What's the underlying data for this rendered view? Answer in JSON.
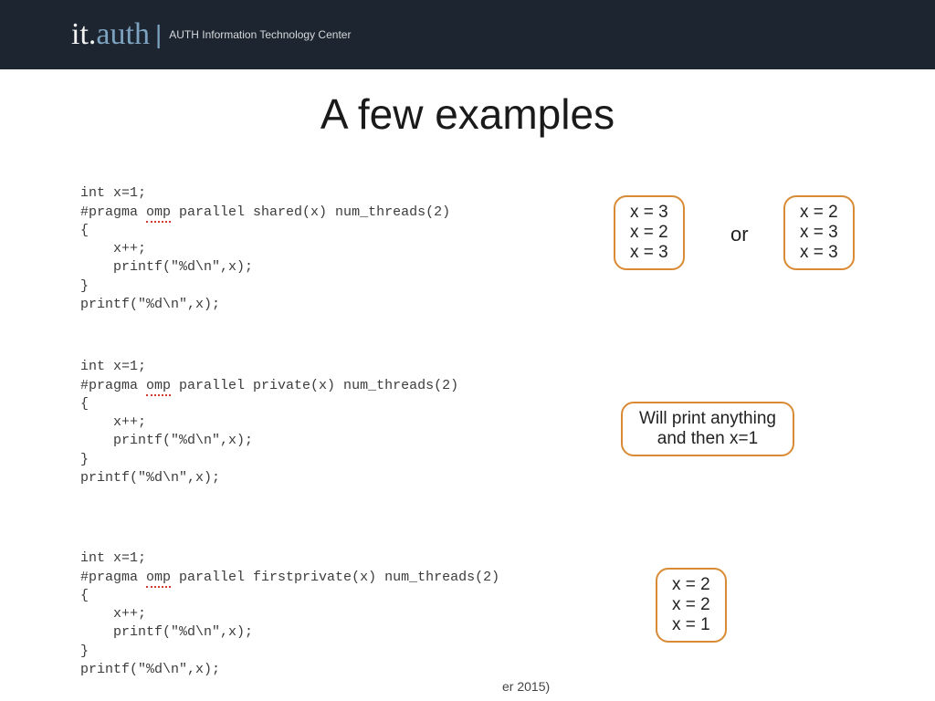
{
  "header": {
    "logo_it": "it.",
    "logo_auth": "auth",
    "separator": "|",
    "subtitle": "AUTH Information Technology Center"
  },
  "title": "A few examples",
  "code1": {
    "l1": "int x=1;",
    "l2a": "#pragma ",
    "l2b": "omp",
    "l2c": " parallel shared(x) num_threads(2)",
    "l3": "{",
    "l4": "    x++;",
    "l5": "    printf(\"%d\\n\",x);",
    "l6": "}",
    "l7": "printf(\"%d\\n\",x);"
  },
  "code2": {
    "l1": "int x=1;",
    "l2a": "#pragma ",
    "l2b": "omp",
    "l2c": " parallel private(x) num_threads(2)",
    "l3": "{",
    "l4": "    x++;",
    "l5": "    printf(\"%d\\n\",x);",
    "l6": "}",
    "l7": "printf(\"%d\\n\",x);"
  },
  "code3": {
    "l1": "int x=1;",
    "l2a": "#pragma ",
    "l2b": "omp",
    "l2c": " parallel firstprivate(x) num_threads(2)",
    "l3": "{",
    "l4": "    x++;",
    "l5": "    printf(\"%d\\n\",x);",
    "l6": "}",
    "l7": "printf(\"%d\\n\",x);"
  },
  "result1a": {
    "r1": "x = 3",
    "r2": "x = 2",
    "r3": "x = 3"
  },
  "result1b": {
    "r1": "x = 2",
    "r2": "x = 3",
    "r3": "x = 3"
  },
  "or_label": "or",
  "result2": {
    "line1": "Will print anything",
    "line2": "and then x=1"
  },
  "result3": {
    "r1": "x = 2",
    "r2": "x = 2",
    "r3": "x = 1"
  },
  "footer": "er 2015)"
}
